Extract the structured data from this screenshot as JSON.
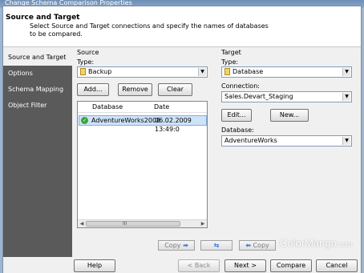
{
  "window": {
    "title": "Change Schema Comparison Properties"
  },
  "header": {
    "title": "Source and Target",
    "description": "Select Source and Target connections and specify the names of databases to be compared."
  },
  "nav": {
    "items": [
      {
        "label": "Source and Target",
        "active": true
      },
      {
        "label": "Options",
        "active": false
      },
      {
        "label": "Schema Mapping",
        "active": false
      },
      {
        "label": "Object Filter",
        "active": false
      }
    ]
  },
  "source": {
    "group_label": "Source",
    "type_label": "Type:",
    "type_value": "Backup",
    "add_label": "Add...",
    "remove_label": "Remove",
    "clear_label": "Clear",
    "list": {
      "col_database": "Database",
      "col_date": "Date",
      "rows": [
        {
          "database": "AdventureWorks2008",
          "date": "06.02.2009 13:49:0"
        }
      ],
      "scroll_mark": "III"
    }
  },
  "target": {
    "group_label": "Target",
    "type_label": "Type:",
    "type_value": "Database",
    "connection_label": "Connection:",
    "connection_value": "Sales.Devart_Staging",
    "edit_label": "Edit...",
    "new_label": "New...",
    "database_label": "Database:",
    "database_value": "AdventureWorks"
  },
  "copybar": {
    "copy_right": "Copy",
    "copy_left": "Copy"
  },
  "footer": {
    "help": "Help",
    "back": "< Back",
    "next": "Next >",
    "compare": "Compare",
    "cancel": "Cancel"
  },
  "watermark": {
    "brand": "ColorMango",
    "tld": ".com"
  },
  "colors": {
    "nav_bg": "#5a5a5a",
    "selection": "#cfe3f7",
    "check_green": "#3aa63a"
  }
}
